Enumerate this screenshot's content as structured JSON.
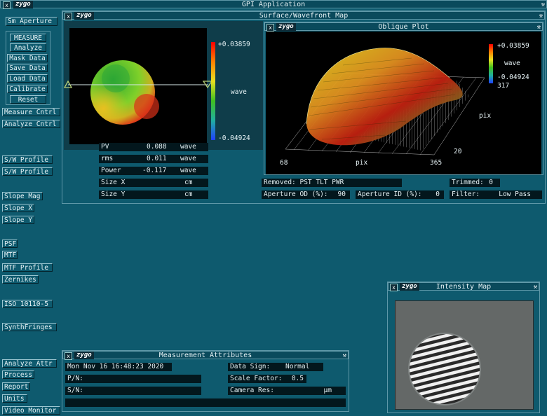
{
  "app": {
    "title": "GPI Application",
    "brand": "zygo"
  },
  "sidebar": {
    "aperture": "Sm Aperture",
    "group": [
      "MEASURE",
      "Analyze",
      "Mask Data",
      "Save Data",
      "Load Data",
      "Calibrate",
      "Reset"
    ],
    "measure_cntrl": "Measure Cntrl",
    "analyze_cntrl": "Analyze Cntrl",
    "sw_profile_1": "S/W Profile",
    "sw_profile_2": "S/W Profile",
    "slope_mag": "Slope Mag",
    "slope_x": "Slope X",
    "slope_y": "Slope Y",
    "psf": "PSF",
    "mtf": "MTF",
    "mtf_profile": "MTF Profile",
    "zernikes": "Zernikes",
    "iso": "ISO 10110-5",
    "synth": "SynthFringes",
    "bottom": [
      "Analyze Attr",
      "Process",
      "Report",
      "Units",
      "Video Monitor"
    ]
  },
  "surface_map": {
    "title": "Surface/Wavefront Map",
    "scale_max": "+0.03859",
    "scale_unit": "wave",
    "scale_min": "-0.04924",
    "stats": [
      {
        "label": "PV",
        "value": "0.088",
        "unit": "wave"
      },
      {
        "label": "rms",
        "value": "0.011",
        "unit": "wave"
      },
      {
        "label": "Power",
        "value": "-0.117",
        "unit": "wave"
      },
      {
        "label": "Size X",
        "value": "",
        "unit": "cm"
      },
      {
        "label": "Size Y",
        "value": "",
        "unit": "cm"
      }
    ]
  },
  "oblique": {
    "title": "Oblique Plot",
    "scale_max": "+0.03859",
    "scale_unit": "wave",
    "scale_min": "-0.04924",
    "extra": "317",
    "x_start": "68",
    "x_label": "pix",
    "x_end": "365",
    "y_label": "pix",
    "y_val": "20"
  },
  "settings": {
    "removed": "Removed: PST TLT PWR",
    "trimmed_label": "Trimmed:",
    "trimmed_value": "0",
    "aperture_od_label": "Aperture OD (%):",
    "aperture_od_value": "90",
    "aperture_id_label": "Aperture ID (%):",
    "aperture_id_value": "0",
    "filter_label": "Filter:",
    "filter_value": "Low Pass"
  },
  "attributes": {
    "title": "Measurement Attributes",
    "date": "Mon Nov 16 16:48:23 2020",
    "pn": "P/N:",
    "sn": "S/N:",
    "data_sign_label": "Data Sign:",
    "data_sign_value": "Normal",
    "scale_factor_label": "Scale Factor:",
    "scale_factor_value": "0.5",
    "camera_res_label": "Camera Res:",
    "camera_res_unit": "µm"
  },
  "intensity": {
    "title": "Intensity Map"
  },
  "colors": {
    "background": "#0e5a6e",
    "field": "#03171d",
    "accent": "#5f98a8"
  }
}
